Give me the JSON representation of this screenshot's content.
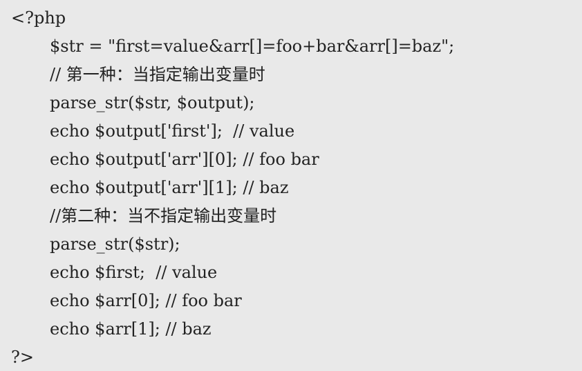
{
  "code": {
    "lines": [
      "<?php",
      "$str = \"first=value&arr[]=foo+bar&arr[]=baz\";",
      "// 第一种：当指定输出变量时",
      "parse_str($str, $output);",
      "echo $output['first'];  // value",
      "echo $output['arr'][0]; // foo bar",
      "echo $output['arr'][1]; // baz",
      "//第二种：当不指定输出变量时",
      "parse_str($str);",
      "echo $first;  // value",
      "echo $arr[0]; // foo bar",
      "echo $arr[1]; // baz",
      "?>"
    ]
  }
}
